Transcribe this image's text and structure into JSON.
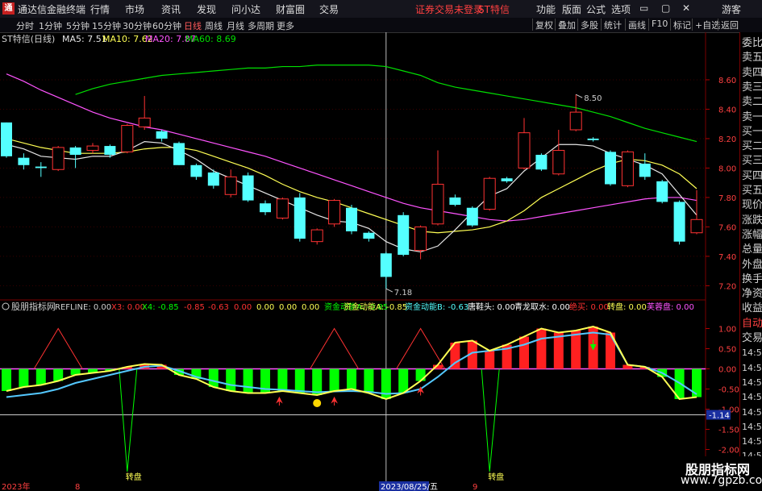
{
  "app": {
    "title": "通达信金融终端",
    "menu": [
      "行情",
      "市场",
      "资讯",
      "发现",
      "问小达",
      "财富圈",
      "交易"
    ],
    "status": "证券交易未登录",
    "stock_tag": "ST特信",
    "right_menu": [
      "功能",
      "版面",
      "公式",
      "选项"
    ],
    "guest": "游客"
  },
  "toolbar": {
    "periods": [
      "分时",
      "1分钟",
      "5分钟",
      "15分钟",
      "30分钟",
      "60分钟",
      "日线",
      "周线",
      "月线",
      "多周期",
      "更多"
    ],
    "active": "日线",
    "right": [
      "复权",
      "叠加",
      "多股",
      "统计",
      "画线",
      "F10",
      "标记",
      "+自选",
      "返回"
    ]
  },
  "price_panel": {
    "title": "ST特信(日线)",
    "ma5_label": "MA5: 7.51",
    "ma10_label": "MA10: 7.62",
    "ma20_label": "MA20: 7.87",
    "ma60_label": "MA60: 8.69",
    "y_ticks": [
      "8.60",
      "8.40",
      "8.20",
      "8.00",
      "7.80",
      "7.60",
      "7.40",
      "7.20"
    ],
    "high_marker": "8.50",
    "low_marker": "7.18"
  },
  "indicator_panel": {
    "name": "股朋指标网",
    "values": [
      "REFLINE: 0.00",
      "X3: 0.00",
      "X4: -0.85",
      "-0.85",
      "-0.63",
      "0.00",
      "0.00",
      "0.00",
      "0.00",
      "资金动能A: -0.85",
      "资金动能B: -0.63",
      "唐鞋头: 0.00",
      "青龙取水: 0.00",
      "绝买: 0.00",
      "转盘: 0.00",
      "芙蓉盘: 0.00"
    ],
    "y_ticks": [
      "1.00",
      "0.50",
      "0.00",
      "-0.50",
      "-1.00",
      "-1.50",
      "-2.00",
      "-2.50"
    ],
    "cur_value": "-1.14",
    "signal_label": "转盘"
  },
  "x_axis": {
    "labels": [
      "2023年",
      "8",
      "2023/08/25/五",
      "9"
    ]
  },
  "sidebar": {
    "items": [
      "委比",
      "卖五",
      "卖四",
      "卖三",
      "卖二",
      "卖一",
      "买一",
      "买二",
      "买三",
      "买四",
      "买五",
      "现价",
      "涨跌",
      "涨幅",
      "总量",
      "外盘",
      "换手",
      "净资",
      "收益",
      "自动",
      "交易",
      "14:56",
      "14:56",
      "14:56",
      "14:56",
      "14:56",
      "14:56",
      "14:56",
      "14:56",
      "14:56"
    ]
  },
  "watermark": {
    "line1": "股朋指标网",
    "line2": "www.7gpzb.com"
  },
  "colors": {
    "up": "#ff3232",
    "down": "#54ffff",
    "ma5": "#e6e6e6",
    "ma10": "#ffff54",
    "ma20": "#ff54ff",
    "ma60": "#00e000",
    "bar_green": "#00ff00",
    "bar_red": "#ff2020"
  },
  "chart_data": {
    "type": "candlestick",
    "candles": [
      {
        "o": 8.31,
        "c": 8.08,
        "h": 8.31,
        "l": 8.07
      },
      {
        "o": 8.07,
        "c": 8.02,
        "h": 8.1,
        "l": 7.99
      },
      {
        "o": 8.01,
        "c": 8.0,
        "h": 8.04,
        "l": 7.94
      },
      {
        "o": 7.99,
        "c": 8.14,
        "h": 8.15,
        "l": 7.98
      },
      {
        "o": 8.14,
        "c": 8.09,
        "h": 8.15,
        "l": 8.0
      },
      {
        "o": 8.12,
        "c": 8.15,
        "h": 8.17,
        "l": 8.1
      },
      {
        "o": 8.15,
        "c": 8.09,
        "h": 8.16,
        "l": 8.07
      },
      {
        "o": 8.11,
        "c": 8.29,
        "h": 8.3,
        "l": 8.1
      },
      {
        "o": 8.28,
        "c": 8.34,
        "h": 8.49,
        "l": 8.26
      },
      {
        "o": 8.25,
        "c": 8.2,
        "h": 8.26,
        "l": 8.18
      },
      {
        "o": 8.17,
        "c": 8.02,
        "h": 8.18,
        "l": 8.02
      },
      {
        "o": 8.02,
        "c": 7.94,
        "h": 8.03,
        "l": 7.92
      },
      {
        "o": 7.97,
        "c": 7.88,
        "h": 7.99,
        "l": 7.86
      },
      {
        "o": 7.82,
        "c": 7.94,
        "h": 7.99,
        "l": 7.8
      },
      {
        "o": 7.95,
        "c": 7.78,
        "h": 7.97,
        "l": 7.77
      },
      {
        "o": 7.76,
        "c": 7.7,
        "h": 7.78,
        "l": 7.68
      },
      {
        "o": 7.66,
        "c": 7.79,
        "h": 7.8,
        "l": 7.65
      },
      {
        "o": 7.8,
        "c": 7.52,
        "h": 7.83,
        "l": 7.5
      },
      {
        "o": 7.5,
        "c": 7.58,
        "h": 7.59,
        "l": 7.48
      },
      {
        "o": 7.62,
        "c": 7.78,
        "h": 7.79,
        "l": 7.6
      },
      {
        "o": 7.73,
        "c": 7.57,
        "h": 7.75,
        "l": 7.55
      },
      {
        "o": 7.56,
        "c": 7.52,
        "h": 7.57,
        "l": 7.5
      },
      {
        "o": 7.42,
        "c": 7.26,
        "h": 7.43,
        "l": 7.18
      },
      {
        "o": 7.68,
        "c": 7.41,
        "h": 7.7,
        "l": 7.4
      },
      {
        "o": 7.44,
        "c": 7.6,
        "h": 7.61,
        "l": 7.38
      },
      {
        "o": 7.62,
        "c": 7.89,
        "h": 8.12,
        "l": 7.61
      },
      {
        "o": 7.8,
        "c": 7.75,
        "h": 7.82,
        "l": 7.74
      },
      {
        "o": 7.73,
        "c": 7.61,
        "h": 7.74,
        "l": 7.6
      },
      {
        "o": 7.72,
        "c": 7.93,
        "h": 7.94,
        "l": 7.71
      },
      {
        "o": 7.93,
        "c": 7.91,
        "h": 7.94,
        "l": 7.9
      },
      {
        "o": 8.0,
        "c": 8.24,
        "h": 8.34,
        "l": 7.99
      },
      {
        "o": 8.09,
        "c": 7.99,
        "h": 8.1,
        "l": 7.98
      },
      {
        "o": 7.96,
        "c": 8.12,
        "h": 8.26,
        "l": 7.95
      },
      {
        "o": 8.26,
        "c": 8.38,
        "h": 8.5,
        "l": 8.25
      },
      {
        "o": 8.2,
        "c": 8.19,
        "h": 8.21,
        "l": 8.18
      },
      {
        "o": 8.11,
        "c": 7.89,
        "h": 8.12,
        "l": 7.88
      },
      {
        "o": 7.88,
        "c": 8.11,
        "h": 8.12,
        "l": 7.87
      },
      {
        "o": 8.03,
        "c": 7.94,
        "h": 8.1,
        "l": 7.92
      },
      {
        "o": 7.91,
        "c": 7.77,
        "h": 7.92,
        "l": 7.76
      },
      {
        "o": 7.77,
        "c": 7.5,
        "h": 7.78,
        "l": 7.48
      },
      {
        "o": 7.56,
        "c": 7.65,
        "h": 7.85,
        "l": 7.55
      }
    ],
    "ma5": [
      8.16,
      8.13,
      8.08,
      8.07,
      8.06,
      8.08,
      8.08,
      8.12,
      8.18,
      8.17,
      8.12,
      8.06,
      7.98,
      7.93,
      7.88,
      7.83,
      7.78,
      7.73,
      7.68,
      7.64,
      7.63,
      7.59,
      7.5,
      7.45,
      7.43,
      7.47,
      7.58,
      7.7,
      7.81,
      7.86,
      7.98,
      8.07,
      8.16,
      8.16,
      8.15,
      8.1,
      8.06,
      8.02,
      7.96,
      7.82,
      7.68
    ],
    "ma10": [
      8.2,
      8.17,
      8.14,
      8.12,
      8.1,
      8.1,
      8.1,
      8.11,
      8.13,
      8.14,
      8.14,
      8.12,
      8.08,
      8.04,
      8.0,
      7.95,
      7.89,
      7.84,
      7.8,
      7.77,
      7.73,
      7.69,
      7.65,
      7.61,
      7.57,
      7.56,
      7.57,
      7.58,
      7.6,
      7.64,
      7.71,
      7.8,
      7.86,
      7.92,
      7.98,
      8.03,
      8.06,
      8.05,
      8.02,
      7.96,
      7.86
    ],
    "ma20": [
      8.64,
      8.59,
      8.53,
      8.48,
      8.43,
      8.38,
      8.34,
      8.31,
      8.28,
      8.26,
      8.23,
      8.2,
      8.17,
      8.14,
      8.11,
      8.08,
      8.04,
      8.0,
      7.96,
      7.92,
      7.88,
      7.84,
      7.8,
      7.76,
      7.73,
      7.71,
      7.69,
      7.67,
      7.65,
      7.64,
      7.65,
      7.67,
      7.69,
      7.71,
      7.73,
      7.75,
      7.77,
      7.79,
      7.8,
      7.8,
      7.78
    ],
    "ma60": [
      null,
      null,
      null,
      null,
      8.5,
      8.54,
      8.57,
      8.59,
      8.61,
      8.63,
      8.64,
      8.65,
      8.66,
      8.67,
      8.68,
      8.68,
      8.69,
      8.69,
      8.7,
      8.7,
      8.7,
      8.7,
      8.69,
      8.66,
      8.63,
      8.58,
      8.55,
      8.53,
      8.51,
      8.49,
      8.47,
      8.45,
      8.43,
      8.41,
      8.38,
      8.35,
      8.31,
      8.27,
      8.24,
      8.21,
      8.18
    ],
    "ylim": [
      7.12,
      8.83
    ],
    "indicator": {
      "bars": [
        -0.55,
        -0.45,
        -0.4,
        -0.3,
        -0.15,
        -0.1,
        -0.05,
        0.05,
        0.12,
        0.1,
        -0.15,
        -0.25,
        -0.45,
        -0.55,
        -0.6,
        -0.6,
        -0.55,
        -0.6,
        -0.65,
        -0.55,
        -0.5,
        -0.6,
        -0.75,
        -0.6,
        -0.3,
        0.1,
        0.65,
        0.7,
        0.45,
        0.6,
        0.8,
        1.0,
        0.9,
        0.95,
        1.05,
        0.9,
        0.1,
        0.05,
        -0.2,
        -0.75,
        -0.7
      ],
      "line_a": [
        -0.55,
        -0.45,
        -0.4,
        -0.3,
        -0.15,
        -0.1,
        -0.05,
        0.05,
        0.12,
        0.1,
        -0.15,
        -0.25,
        -0.45,
        -0.55,
        -0.6,
        -0.6,
        -0.55,
        -0.6,
        -0.65,
        -0.55,
        -0.5,
        -0.6,
        -0.75,
        -0.6,
        -0.3,
        0.1,
        0.65,
        0.7,
        0.45,
        0.6,
        0.8,
        1.0,
        0.9,
        0.95,
        1.05,
        0.9,
        0.1,
        0.05,
        -0.2,
        -0.75,
        -0.7
      ],
      "line_b": [
        -0.7,
        -0.65,
        -0.6,
        -0.5,
        -0.35,
        -0.25,
        -0.15,
        -0.05,
        0.05,
        0.08,
        -0.05,
        -0.2,
        -0.3,
        -0.4,
        -0.45,
        -0.5,
        -0.52,
        -0.55,
        -0.58,
        -0.56,
        -0.55,
        -0.57,
        -0.62,
        -0.6,
        -0.5,
        -0.2,
        0.15,
        0.4,
        0.45,
        0.5,
        0.6,
        0.75,
        0.8,
        0.85,
        0.9,
        0.85,
        0.1,
        0.05,
        -0.1,
        -0.35,
        -0.63
      ],
      "peaks": [
        3,
        19,
        24
      ],
      "dips": [
        7,
        28
      ],
      "up_arrows": [
        16,
        19,
        24
      ],
      "smiley": 18,
      "down_arrow": 34,
      "ylim": [
        -2.75,
        1.35
      ]
    }
  }
}
